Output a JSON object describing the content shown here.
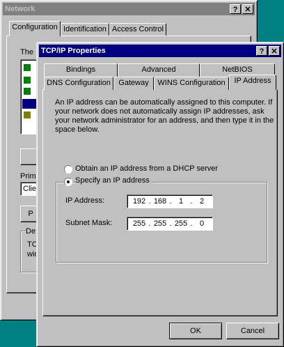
{
  "network_window": {
    "title": "Network",
    "tabs": [
      "Configuration",
      "Identification",
      "Access Control"
    ],
    "partial_label_the": "The",
    "partial_primary": "Prima",
    "partial_client": "Clie",
    "partial_desc": "De",
    "partial_desc_text1": "TC",
    "partial_desc_text2": "wid",
    "partial_button": "P"
  },
  "tcpip_dialog": {
    "title": "TCP/IP Properties",
    "help_button": "?",
    "close_button": "✕",
    "tabs_back_row": [
      "Bindings",
      "Advanced",
      "NetBIOS"
    ],
    "tabs_front_row": [
      "DNS Configuration",
      "Gateway",
      "WINS Configuration",
      "IP Address"
    ],
    "description": "An IP address can be automatically assigned to this computer. If your network does not automatically assign IP addresses, ask your network administrator for an address, and then type it in the space below.",
    "radio_dhcp": "Obtain an IP address from a DHCP server",
    "radio_specify": "Specify an IP address",
    "ip_address_label": "IP Address:",
    "subnet_mask_label": "Subnet Mask:",
    "ip_address": [
      "192",
      "168",
      "1",
      "2"
    ],
    "subnet_mask": [
      "255",
      "255",
      "255",
      "0"
    ],
    "ok_label": "OK",
    "cancel_label": "Cancel",
    "selected_option": "specify"
  }
}
